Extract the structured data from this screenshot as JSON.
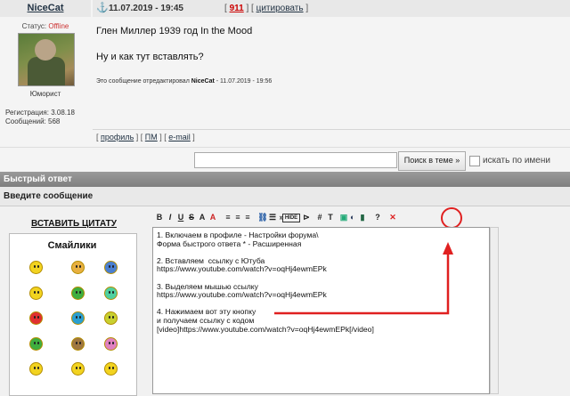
{
  "post": {
    "author": "NiceCat",
    "date": "11.07.2019 - 19:45",
    "number": "911",
    "quote_label": "цитировать",
    "status_label": "Статус:",
    "status_value": "Offline",
    "rank": "Юморист",
    "reg_line": "Регистрация: 3.08.18",
    "msgs_line": "Сообщений: 568",
    "line1": "Глен Миллер 1939 год In the Mood",
    "line2": "Ну и как тут вставлять?",
    "edit_note_prefix": "Это сообщение отредактировал",
    "edit_note_user": "NiceCat",
    "edit_note_suffix": "- 11.07.2019 - 19:56",
    "links": {
      "profile": "профиль",
      "pm": "ПМ",
      "email": "e-mail"
    }
  },
  "search": {
    "value": "",
    "button": "Поиск в теме »",
    "name_checkbox": "искать по имени",
    "name_checked": false
  },
  "quick_reply": {
    "title": "Быстрый ответ",
    "enter_message": "Введите сообщение",
    "insert_quote": "ВСТАВИТЬ ЦИТАТУ",
    "smileys_title": "Смайлики",
    "editor_text": "1. Включаем в профиле - Настройки форума\\\nФорма быстрого ответа * - Расширенная\n\n2. Вставляем  ссылку с Ютуба\nhttps://www.youtube.com/watch?v=oqHj4ewmEPk\n\n3. Выделяем мышью ссылку\nhttps://www.youtube.com/watch?v=oqHj4ewmEPk\n\n4. Нажимаем вот эту кнопку\nи получаем ссылку с кодом\n[video]https://www.youtube.com/watch?v=oqHj4ewmEPk[/video]"
  },
  "toolbar": [
    {
      "name": "bold-button",
      "glyph": "B"
    },
    {
      "name": "italic-button",
      "glyph": "I"
    },
    {
      "name": "underline-button",
      "glyph": "U"
    },
    {
      "name": "strike-button",
      "glyph": "S"
    },
    {
      "name": "font-size-button",
      "glyph": "A"
    },
    {
      "name": "font-color-button",
      "glyph": "A"
    },
    {
      "name": "align-left-button",
      "glyph": "≡"
    },
    {
      "name": "align-center-button",
      "glyph": "≡"
    },
    {
      "name": "align-right-button",
      "glyph": "≡"
    },
    {
      "name": "link-button",
      "glyph": "⛓"
    },
    {
      "name": "list-button",
      "glyph": "☰"
    },
    {
      "name": "quote-button",
      "glyph": "»"
    },
    {
      "name": "hide-button",
      "glyph": "HIDE"
    },
    {
      "name": "code-button",
      "glyph": "⊳"
    },
    {
      "name": "hash-button",
      "glyph": "#"
    },
    {
      "name": "text-button",
      "glyph": "T"
    },
    {
      "name": "image-button",
      "glyph": "▣"
    },
    {
      "name": "flash-button",
      "glyph": "◐"
    },
    {
      "name": "video-button",
      "glyph": "▮"
    },
    {
      "name": "help-button",
      "glyph": "?"
    },
    {
      "name": "close-button",
      "glyph": "✕"
    }
  ],
  "colors": {
    "accent": "#234",
    "highlight_red": "#e02020",
    "header_bar": "#8a8a8a"
  }
}
